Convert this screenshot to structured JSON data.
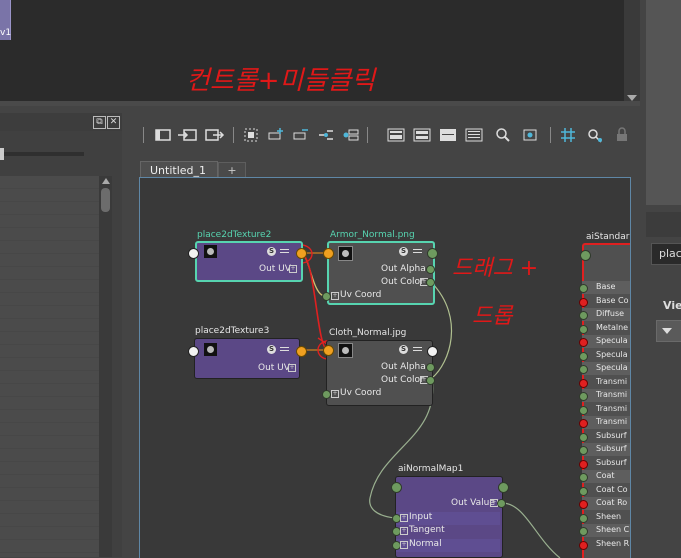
{
  "top": {
    "thumb_label": "v1"
  },
  "right_panel": {
    "field_value": "plac",
    "section_label": "Vie"
  },
  "left_panel": {
    "header_icons": [
      "float-icon",
      "close-icon"
    ],
    "close_glyph": "✕",
    "float_glyph": "⧉"
  },
  "toolbar": {
    "icons": [
      "panel-left-icon",
      "graph-in-icon",
      "graph-out-icon",
      "graph-up-icon",
      "frame-icon",
      "add-icon",
      "remove-icon",
      "clear-icon",
      "rearrange-icon",
      "layout1-icon",
      "layout2-icon",
      "layout3-icon",
      "layout4-icon",
      "search-icon",
      "snapshot-icon",
      "grid-icon",
      "pin-icon",
      "lock-icon"
    ]
  },
  "tabs": [
    {
      "label": "Untitled_1"
    },
    {
      "label": "+"
    }
  ],
  "nodes": {
    "place2dTexture2": {
      "title": "place2dTexture2",
      "out": "Out UV"
    },
    "place2dTexture3": {
      "title": "place2dTexture3",
      "out": "Out UV"
    },
    "armor": {
      "title": "Armor_Normal.png",
      "out_alpha": "Out Alpha",
      "out_color": "Out Color",
      "uv": "Uv Coord"
    },
    "cloth": {
      "title": "Cloth_Normal.jpg",
      "out_alpha": "Out Alpha",
      "out_color": "Out Color",
      "uv": "Uv Coord"
    },
    "normal_map": {
      "title": "aiNormalMap1",
      "out": "Out Value",
      "inputs": [
        "Input",
        "Tangent",
        "Normal"
      ]
    },
    "ai_standard": {
      "title": "aiStandar",
      "attrs": [
        "Base",
        "Base Co",
        "Diffuse",
        "Metalne",
        "Specula",
        "Specula",
        "Specula",
        "Transmi",
        "Transmi",
        "Transmi",
        "Transmi",
        "Subsurf",
        "Subsurf",
        "Subsurf",
        "Coat",
        "Coat Co",
        "Coat Ro",
        "Sheen",
        "Sheen C",
        "Sheen R"
      ]
    }
  },
  "annotations": {
    "top_note": "컨트롤+미들클릭",
    "side_note_1": "드래그 +",
    "side_note_2": "드롭"
  },
  "colors": {
    "accent_selected": "#57d4b0",
    "annotation": "#e01818",
    "node_purple": "#5b4886",
    "port_orange": "#f0a020"
  }
}
